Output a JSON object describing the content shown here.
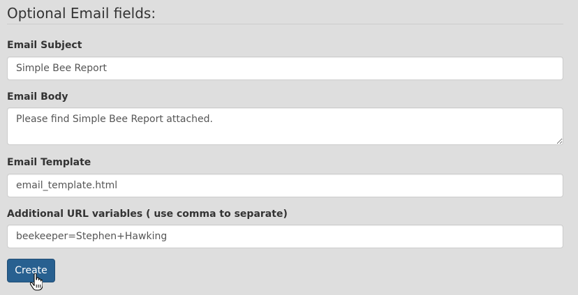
{
  "section": {
    "title": "Optional Email fields:"
  },
  "fields": {
    "subject": {
      "label": "Email Subject",
      "value": "Simple Bee Report"
    },
    "body": {
      "label": "Email Body",
      "value": "Please find Simple Bee Report attached."
    },
    "template": {
      "label": "Email Template",
      "value": "email_template.html"
    },
    "url_vars": {
      "label": "Additional URL variables ( use comma to separate)",
      "value": "beekeeper=Stephen+Hawking"
    }
  },
  "actions": {
    "create_label": "Create"
  },
  "colors": {
    "background": "#dedede",
    "primary_button": "#286090",
    "input_border": "#cccccc"
  },
  "icons": {
    "cursor": "hand-pointer-icon"
  }
}
